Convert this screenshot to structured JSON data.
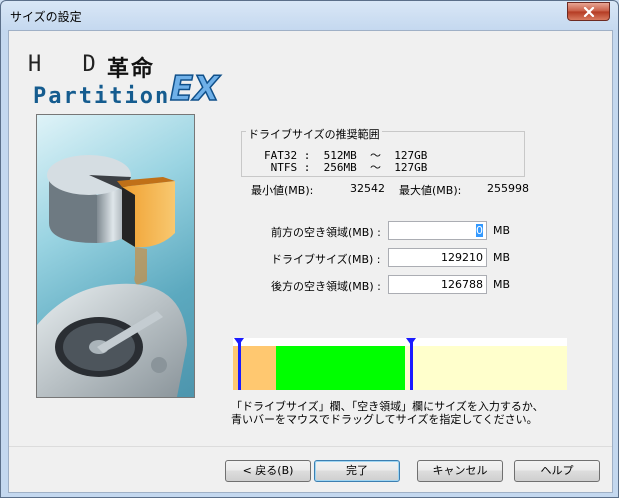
{
  "window": {
    "title": "サイズの設定"
  },
  "logo": {
    "line1": "H D",
    "kanji": "革命",
    "line2": "Partition",
    "ex": "EX"
  },
  "range": {
    "title": "ドライブサイズの推奨範囲",
    "fat32": "FAT32 :  512MB  ～  127GB",
    "ntfs": " NTFS :  256MB  ～  127GB"
  },
  "limits": {
    "min_label": "最小値(MB):",
    "min_value": "32542",
    "max_label": "最大値(MB):",
    "max_value": "255998"
  },
  "fields": {
    "front_label": "前方の空き領域(MB) :",
    "front_value": "0",
    "size_label": "ドライブサイズ(MB) :",
    "size_value": "129210",
    "back_label": "後方の空き領域(MB) :",
    "back_value": "126788",
    "unit": "MB"
  },
  "partition_bar": {
    "colors": {
      "front": "#ffc870",
      "drive": "#00ff00",
      "back": "#ffffcc",
      "handle": "#1b1bff"
    },
    "segments_fraction": {
      "front": 0.13,
      "drive": 0.385,
      "back": 0.485
    }
  },
  "instructions": {
    "line1": "「ドライブサイズ」欄、「空き領域」欄にサイズを入力するか、",
    "line2": "青いバーをマウスでドラッグしてサイズを指定してください。"
  },
  "buttons": {
    "back": "< 戻る(B)",
    "finish": "完了",
    "cancel": "キャンセル",
    "help": "ヘルプ"
  },
  "icons": {
    "close": "close-icon"
  }
}
